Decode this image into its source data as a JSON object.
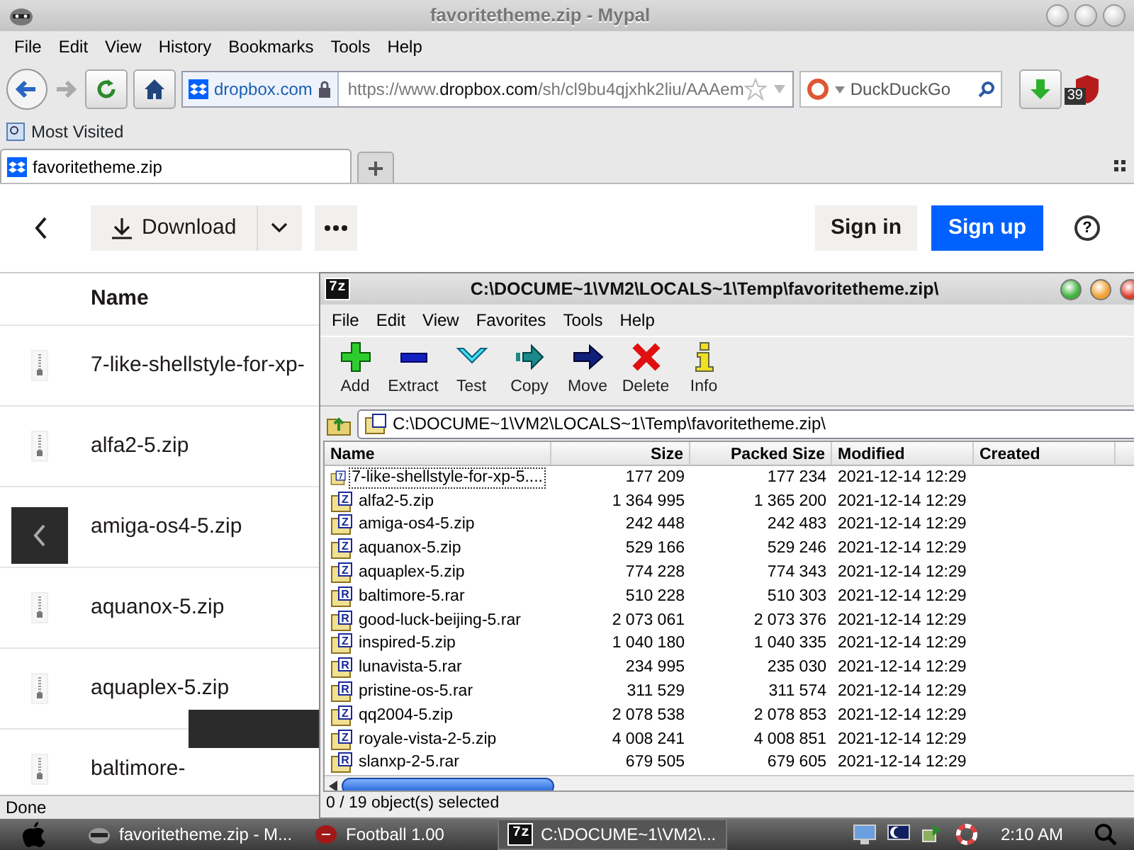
{
  "browser": {
    "title": "favoritetheme.zip - Mypal",
    "menu": [
      "File",
      "Edit",
      "View",
      "History",
      "Bookmarks",
      "Tools",
      "Help"
    ],
    "identity": "dropbox.com",
    "url": [
      {
        "text": "https://www.",
        "strong": false
      },
      {
        "text": "dropbox.com",
        "strong": true
      },
      {
        "text": "/sh/cl9bu4qjxhk2liu/AAAem",
        "strong": false
      }
    ],
    "search_engine": "DuckDuckGo",
    "addon_badge": "39",
    "bookmarks": [
      "Most Visited"
    ],
    "tabs": [
      {
        "label": "favoritetheme.zip",
        "selected": true
      }
    ],
    "status": "Done"
  },
  "page": {
    "download": "Download",
    "sign_in": "Sign in",
    "sign_up": "Sign up",
    "help": "?",
    "column": "Name",
    "files": [
      "7-like-shellstyle-for-xp-",
      "alfa2-5.zip",
      "amiga-os4-5.zip",
      "aquanox-5.zip",
      "aquaplex-5.zip",
      "baltimore-"
    ]
  },
  "archiver": {
    "logo": "7z",
    "title": "C:\\DOCUME~1\\VM2\\LOCALS~1\\Temp\\favoritetheme.zip\\",
    "menu": [
      "File",
      "Edit",
      "View",
      "Favorites",
      "Tools",
      "Help"
    ],
    "tools": [
      {
        "label": "Add",
        "kind": "add"
      },
      {
        "label": "Extract",
        "kind": "extract"
      },
      {
        "label": "Test",
        "kind": "test"
      },
      {
        "label": "Copy",
        "kind": "copy"
      },
      {
        "label": "Move",
        "kind": "move"
      },
      {
        "label": "Delete",
        "kind": "delete"
      },
      {
        "label": "Info",
        "kind": "info"
      }
    ],
    "path": "C:\\DOCUME~1\\VM2\\LOCALS~1\\Temp\\favoritetheme.zip\\",
    "columns": [
      "Name",
      "Size",
      "Packed Size",
      "Modified",
      "Created"
    ],
    "rows": [
      {
        "mark": "7",
        "name": "7-like-shellstyle-for-xp-5....",
        "size": "177 209",
        "packed": "177 234",
        "modified": "2021-12-14 12:29",
        "focused": true
      },
      {
        "mark": "Z",
        "name": "alfa2-5.zip",
        "size": "1 364 995",
        "packed": "1 365 200",
        "modified": "2021-12-14 12:29",
        "focused": false
      },
      {
        "mark": "Z",
        "name": "amiga-os4-5.zip",
        "size": "242 448",
        "packed": "242 483",
        "modified": "2021-12-14 12:29",
        "focused": false
      },
      {
        "mark": "Z",
        "name": "aquanox-5.zip",
        "size": "529 166",
        "packed": "529 246",
        "modified": "2021-12-14 12:29",
        "focused": false
      },
      {
        "mark": "Z",
        "name": "aquaplex-5.zip",
        "size": "774 228",
        "packed": "774 343",
        "modified": "2021-12-14 12:29",
        "focused": false
      },
      {
        "mark": "R",
        "name": "baltimore-5.rar",
        "size": "510 228",
        "packed": "510 303",
        "modified": "2021-12-14 12:29",
        "focused": false
      },
      {
        "mark": "R",
        "name": "good-luck-beijing-5.rar",
        "size": "2 073 061",
        "packed": "2 073 376",
        "modified": "2021-12-14 12:29",
        "focused": false
      },
      {
        "mark": "Z",
        "name": "inspired-5.zip",
        "size": "1 040 180",
        "packed": "1 040 335",
        "modified": "2021-12-14 12:29",
        "focused": false
      },
      {
        "mark": "R",
        "name": "lunavista-5.rar",
        "size": "234 995",
        "packed": "235 030",
        "modified": "2021-12-14 12:29",
        "focused": false
      },
      {
        "mark": "R",
        "name": "pristine-os-5.rar",
        "size": "311 529",
        "packed": "311 574",
        "modified": "2021-12-14 12:29",
        "focused": false
      },
      {
        "mark": "Z",
        "name": "qq2004-5.zip",
        "size": "2 078 538",
        "packed": "2 078 853",
        "modified": "2021-12-14 12:29",
        "focused": false
      },
      {
        "mark": "Z",
        "name": "royale-vista-2-5.zip",
        "size": "4 008 241",
        "packed": "4 008 851",
        "modified": "2021-12-14 12:29",
        "focused": false
      },
      {
        "mark": "R",
        "name": "slanxp-2-5.rar",
        "size": "679 505",
        "packed": "679 605",
        "modified": "2021-12-14 12:29",
        "focused": false
      }
    ],
    "status": "0 / 19 object(s) selected"
  },
  "taskbar": {
    "items": [
      {
        "kind": "browser",
        "label": "favoritetheme.zip - M...",
        "selected": false
      },
      {
        "kind": "game",
        "label": "Football 1.00",
        "selected": false
      },
      {
        "kind": "archiver",
        "logo": "7z",
        "label": "C:\\DOCUME~1\\VM2\\...",
        "selected": true
      }
    ],
    "clock": "2:10 AM"
  }
}
